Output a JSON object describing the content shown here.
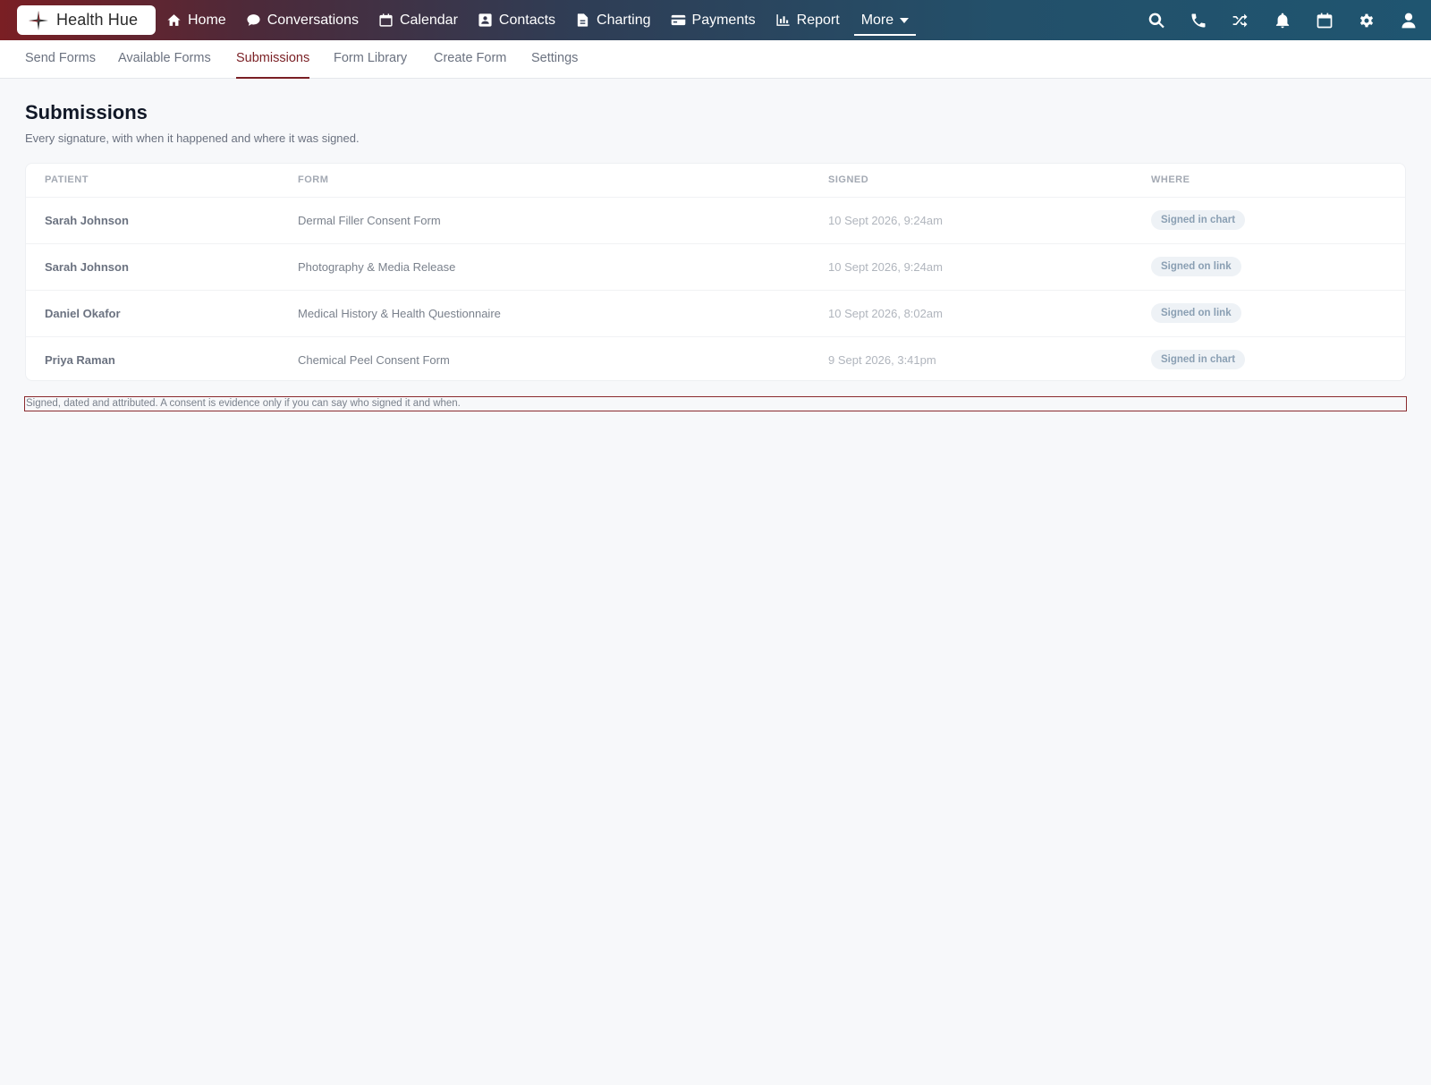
{
  "brand": {
    "name": "Health Hue"
  },
  "nav": {
    "items": [
      {
        "label": "Home",
        "icon": "home-icon"
      },
      {
        "label": "Conversations",
        "icon": "chat-icon"
      },
      {
        "label": "Calendar",
        "icon": "calendar-icon"
      },
      {
        "label": "Contacts",
        "icon": "contact-card-icon"
      },
      {
        "label": "Charting",
        "icon": "document-icon"
      },
      {
        "label": "Payments",
        "icon": "credit-card-icon"
      },
      {
        "label": "Report",
        "icon": "bar-chart-icon"
      }
    ],
    "more_label": "More"
  },
  "toolbar_icons": [
    "search-icon",
    "phone-icon",
    "shuffle-icon",
    "bell-icon",
    "calendar-icon",
    "gear-icon",
    "user-icon"
  ],
  "subtabs": [
    {
      "label": "Send Forms"
    },
    {
      "label": "Available Forms"
    },
    {
      "label": "Submissions",
      "active": true
    },
    {
      "label": "Form Library"
    },
    {
      "label": "Create Form"
    },
    {
      "label": "Settings"
    }
  ],
  "page": {
    "title": "Submissions",
    "subtitle": "Every signature, with when it happened and where it was signed."
  },
  "table": {
    "columns": [
      "PATIENT",
      "FORM",
      "SIGNED",
      "WHERE"
    ],
    "rows": [
      {
        "patient": "Sarah Johnson",
        "form": "Dermal Filler Consent Form",
        "signed": "10 Sept 2026, 9:24am",
        "where": "Signed in chart"
      },
      {
        "patient": "Sarah Johnson",
        "form": "Photography & Media Release",
        "signed": "10 Sept 2026, 9:24am",
        "where": "Signed on link"
      },
      {
        "patient": "Daniel Okafor",
        "form": "Medical History & Health Questionnaire",
        "signed": "10 Sept 2026, 8:02am",
        "where": "Signed on link"
      },
      {
        "patient": "Priya Raman",
        "form": "Chemical Peel Consent Form",
        "signed": "9 Sept 2026, 3:41pm",
        "where": "Signed in chart"
      }
    ]
  },
  "note": "Signed, dated and attributed. A consent is evidence only if you can say who signed it and when.",
  "colors": {
    "brand_dark_red": "#7a1f24",
    "header_teal": "#1f5570",
    "badge_bg": "#eef2f6",
    "badge_text": "#8a9fb3"
  }
}
